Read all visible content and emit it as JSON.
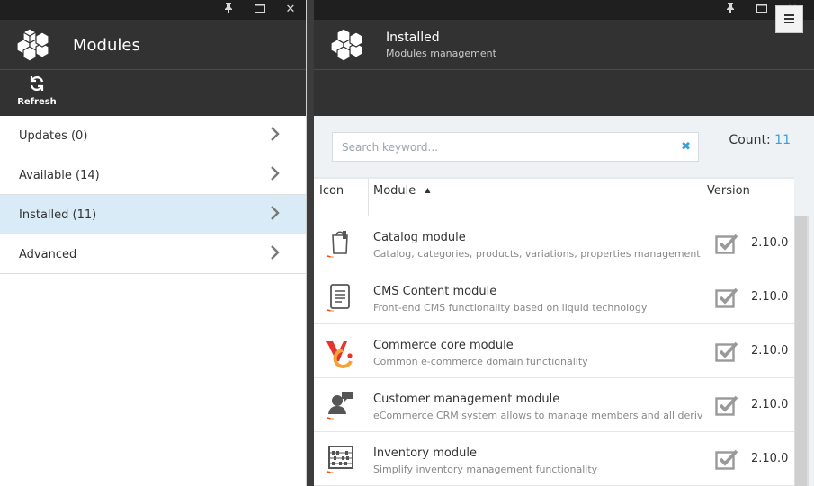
{
  "left_blade": {
    "title": "Modules",
    "toolbar": {
      "refresh_label": "Refresh"
    },
    "menu": [
      {
        "label": "Updates (0)"
      },
      {
        "label": "Available (14)"
      },
      {
        "label": "Installed (11)",
        "active": true
      },
      {
        "label": "Advanced"
      }
    ]
  },
  "right_blade": {
    "title": "Installed",
    "subtitle": "Modules management",
    "search": {
      "placeholder": "Search keyword...",
      "value": ""
    },
    "count_label": "Count:",
    "count_value": "11",
    "columns": {
      "icon": "Icon",
      "module": "Module",
      "version": "Version"
    },
    "sort": "module-ascending",
    "rows": [
      {
        "name": "Catalog module",
        "desc": "Catalog, categories, products, variations, properties management",
        "version": "2.10.0",
        "icon": "shopping-bag-icon"
      },
      {
        "name": "CMS Content module",
        "desc": "Front-end CMS functionality based on liquid technology",
        "version": "2.10.0",
        "icon": "document-icon"
      },
      {
        "name": "Commerce core module",
        "desc": "Common e-commerce domain functionality",
        "version": "2.10.0",
        "icon": "commerce-logo-icon"
      },
      {
        "name": "Customer management module",
        "desc": "eCommerce CRM system allows to manage members and all derived",
        "version": "2.10.0",
        "icon": "customer-chat-icon"
      },
      {
        "name": "Inventory module",
        "desc": "Simplify inventory management functionality",
        "version": "2.10.0",
        "icon": "abacus-icon"
      }
    ]
  },
  "colors": {
    "accent": "#3aa0d8",
    "dark_header": "#323232",
    "topbar": "#1f1f1f",
    "active_item": "#d9ebf6"
  }
}
